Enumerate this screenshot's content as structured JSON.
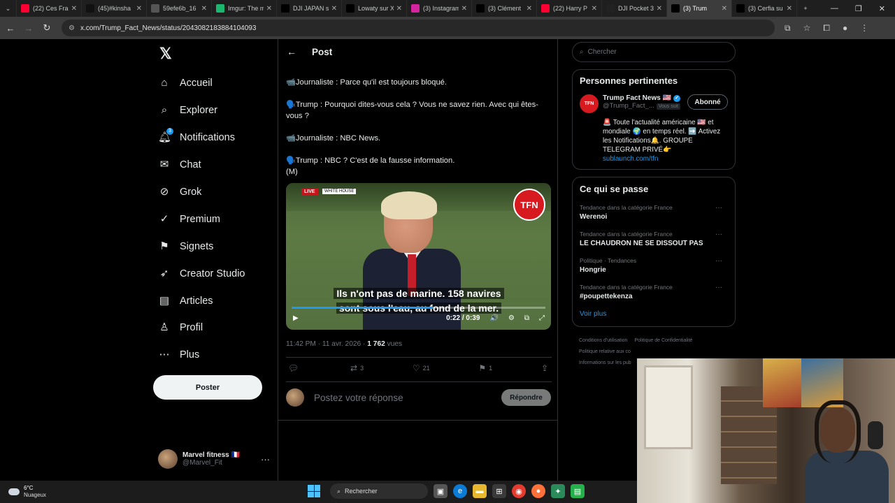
{
  "browser": {
    "tabs": [
      {
        "label": "(22) Ces Fran",
        "color": "#ff0033",
        "icon": "youtube-icon"
      },
      {
        "label": "(45)#kinsha",
        "color": "#111111",
        "icon": "tiktok-icon"
      },
      {
        "label": "59efe6b_16",
        "color": "#555555",
        "icon": "globe-icon"
      },
      {
        "label": "Imgur: The m",
        "color": "#1bb76e",
        "icon": "imgur-icon"
      },
      {
        "label": "DJI JAPAN s",
        "color": "#000000",
        "icon": "x-icon"
      },
      {
        "label": "Lowaty sur X",
        "color": "#000000",
        "icon": "x-icon"
      },
      {
        "label": "(3) Instagram",
        "color": "#d6249f",
        "icon": "instagram-icon"
      },
      {
        "label": "(3) Clément",
        "color": "#000000",
        "icon": "x-icon"
      },
      {
        "label": "(22) Harry P",
        "color": "#ff0033",
        "icon": "youtube-icon"
      },
      {
        "label": "DJI Pocket 3",
        "color": "#222222",
        "icon": "dji-icon"
      },
      {
        "label": "(3) Trum",
        "color": "#000000",
        "icon": "x-icon",
        "active": true
      },
      {
        "label": "(3) Cerfia su",
        "color": "#000000",
        "icon": "x-icon"
      }
    ],
    "url": "x.com/Trump_Fact_News/status/2043082183884104093"
  },
  "sidebar": {
    "items": [
      {
        "label": "Accueil",
        "icon": "home-icon"
      },
      {
        "label": "Explorer",
        "icon": "search-icon"
      },
      {
        "label": "Notifications",
        "icon": "bell-icon",
        "badge": "3"
      },
      {
        "label": "Chat",
        "icon": "chat-icon"
      },
      {
        "label": "Grok",
        "icon": "grok-icon"
      },
      {
        "label": "Premium",
        "icon": "premium-icon"
      },
      {
        "label": "Signets",
        "icon": "bookmark-icon"
      },
      {
        "label": "Creator Studio",
        "icon": "rocket-icon"
      },
      {
        "label": "Articles",
        "icon": "article-icon"
      },
      {
        "label": "Profil",
        "icon": "profile-icon"
      },
      {
        "label": "Plus",
        "icon": "more-icon"
      }
    ],
    "post_button": "Poster",
    "account": {
      "name": "Marvel fitness 🇫🇷",
      "handle": "@Marvel_Fit"
    }
  },
  "main": {
    "title": "Post",
    "tweet_lines": [
      "📹Journaliste : Parce qu'il est toujours bloqué.",
      "🗣️Trump : Pourquoi dites-vous cela ? Vous ne savez rien. Avec qui êtes-vous ?",
      "📹Journaliste : NBC News.",
      "🗣️Trump : NBC ? C'est de la fausse information.\n(M)"
    ],
    "video": {
      "live": "LIVE",
      "white_house": "WHITE HOUSE",
      "logo": "TFN",
      "subtitle_1": "Ils n'ont pas de marine. 158 navires",
      "subtitle_2": "sont sous l'eau, au fond de la mer.",
      "time": "0:22 / 0:39",
      "progress": 0.56
    },
    "meta_time": "11:42 PM · 11 avr. 2026 · ",
    "meta_views": "1 762",
    "meta_views_label": " vues",
    "actions": {
      "reply": "",
      "repost": "3",
      "like": "21",
      "bookmark": "1"
    },
    "reply_placeholder": "Postez votre réponse",
    "reply_button": "Répondre"
  },
  "right": {
    "search_placeholder": "Chercher",
    "relevant_title": "Personnes pertinentes",
    "person": {
      "name": "Trump Fact News 🇺🇸",
      "handle": "@Trump_Fact_...",
      "follows_you": "Vous suit",
      "follow_button": "Abonné",
      "bio": "🚨 Toute l'actualité américaine 🇺🇸 et mondiale 🌍 en temps réel. ➡️ Activez les Notifications🔔. GROUPE TELEGRAM PRIVÉ👉",
      "link": "sublaunch.com/tfn"
    },
    "trends_title": "Ce qui se passe",
    "trends": [
      {
        "category": "Tendance dans la catégorie France",
        "name": "Werenoi"
      },
      {
        "category": "Tendance dans la catégorie France",
        "name": "LE CHAUDRON NE SE DISSOUT PAS"
      },
      {
        "category": "Politique · Tendances",
        "name": "Hongrie"
      },
      {
        "category": "Tendance dans la catégorie France",
        "name": "#poupettekenza"
      }
    ],
    "see_more": "Voir plus",
    "footer": [
      "Conditions d'utilisation",
      "Politique de Confidentialité",
      "Politique relative aux co",
      "Informations sur les pub"
    ]
  },
  "taskbar": {
    "temp": "6°C",
    "weather": "Nuageux",
    "search": "Rechercher"
  }
}
